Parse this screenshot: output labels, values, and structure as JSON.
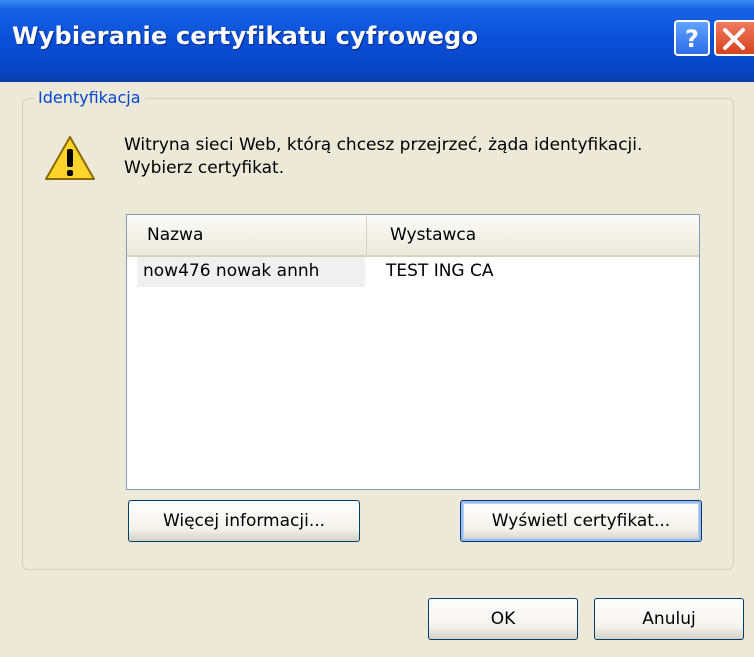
{
  "window": {
    "title": "Wybieranie certyfikatu cyfrowego",
    "help_glyph": "?",
    "close_glyph": "✕"
  },
  "group": {
    "label": "Identyfikacja"
  },
  "message": "Witryna sieci Web, którą chcesz przejrzeć, żąda identyfikacji. Wybierz certyfikat.",
  "certificate_list": {
    "columns": [
      "Nazwa",
      "Wystawca"
    ],
    "rows": [
      [
        "now476  nowak annh",
        "TEST ING CA"
      ]
    ]
  },
  "buttons": {
    "more_info": "Więcej informacji...",
    "view_certificate": "Wyświetl certyfikat...",
    "ok": "OK",
    "cancel": "Anuluj"
  },
  "icons": {
    "warning": "warning-icon",
    "help": "help-icon",
    "close": "close-icon"
  },
  "colors": {
    "titlebar": "#0A4FD8",
    "dialog_bg": "#ECE9D8",
    "group_label": "#0046D5",
    "close_button": "#D8431E"
  }
}
